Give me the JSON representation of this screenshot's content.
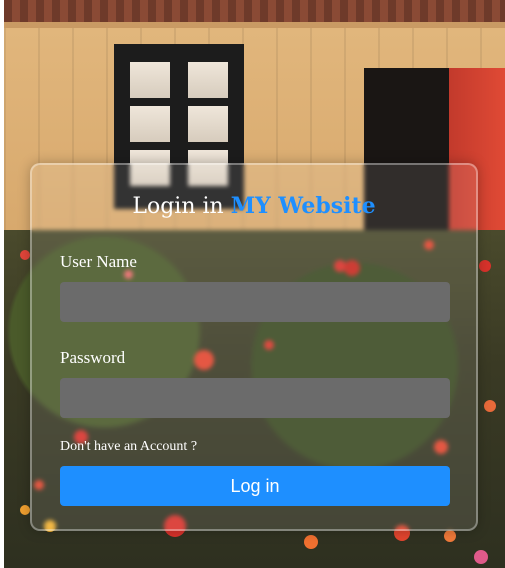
{
  "login": {
    "title_prefix": "Login  in ",
    "title_brand": "MY  Website",
    "username_label": "User Name",
    "username_value": "",
    "password_label": "Password",
    "password_value": "",
    "signup_prompt": "Don't have an Account ?",
    "submit_label": "Log in"
  },
  "colors": {
    "accent": "#1e8fff",
    "field_bg": "#6b6b6b",
    "text": "#ffffff"
  }
}
